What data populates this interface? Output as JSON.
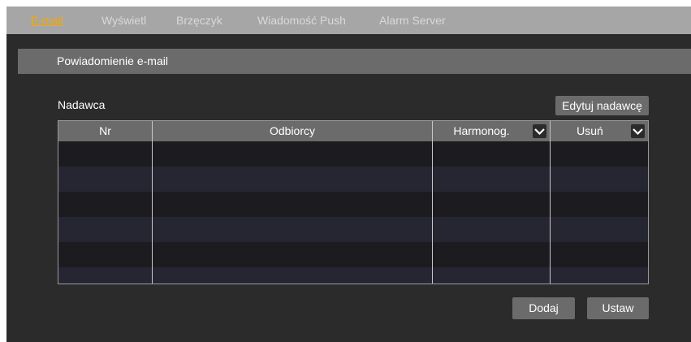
{
  "tabs": [
    {
      "label": "E-mail",
      "active": true
    },
    {
      "label": "Wyświetl",
      "active": false
    },
    {
      "label": "Brzęczyk",
      "active": false
    },
    {
      "label": "Wiadomość Push",
      "active": false
    },
    {
      "label": "Alarm Server",
      "active": false
    }
  ],
  "section": {
    "title": "Powiadomienie e-mail"
  },
  "sender": {
    "label": "Nadawca",
    "edit_button": "Edytuj nadawcę"
  },
  "table": {
    "columns": [
      "Nr",
      "Odbiorcy",
      "Harmonog.",
      "Usuń"
    ],
    "rows": []
  },
  "buttons": {
    "add": "Dodaj",
    "set": "Ustaw"
  },
  "colors": {
    "accent": "#f7a800",
    "background": "#2b2b2b",
    "header": "#6b6b6b",
    "tabbar": "#a6a6a6"
  },
  "icons": {
    "dropdown": "chevron-down-icon"
  }
}
